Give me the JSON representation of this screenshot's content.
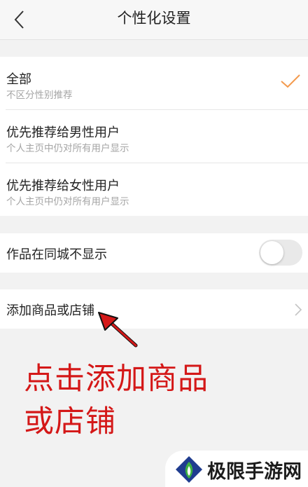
{
  "header": {
    "title": "个性化设置",
    "back_icon": "chevron-left-icon"
  },
  "recommend_group": {
    "items": [
      {
        "title": "全部",
        "subtitle": "不区分性别推荐",
        "selected": true
      },
      {
        "title": "优先推荐给男性用户",
        "subtitle": "个人主页中仍对所有用户显示",
        "selected": false
      },
      {
        "title": "优先推荐给女性用户",
        "subtitle": "个人主页中仍对所有用户显示",
        "selected": false
      }
    ],
    "check_icon": "checkmark-icon"
  },
  "city_group": {
    "label": "作品在同城不显示",
    "toggle_on": false
  },
  "shop_group": {
    "label": "添加商品或店铺",
    "chevron_icon": "chevron-right-icon"
  },
  "annotation": {
    "line1": "点击添加商品",
    "line2": "或店铺"
  },
  "watermark": {
    "text": "极限手游网"
  },
  "colors": {
    "accent": "#f39a4d",
    "annotation": "#d41818",
    "background": "#f2f2f2"
  }
}
